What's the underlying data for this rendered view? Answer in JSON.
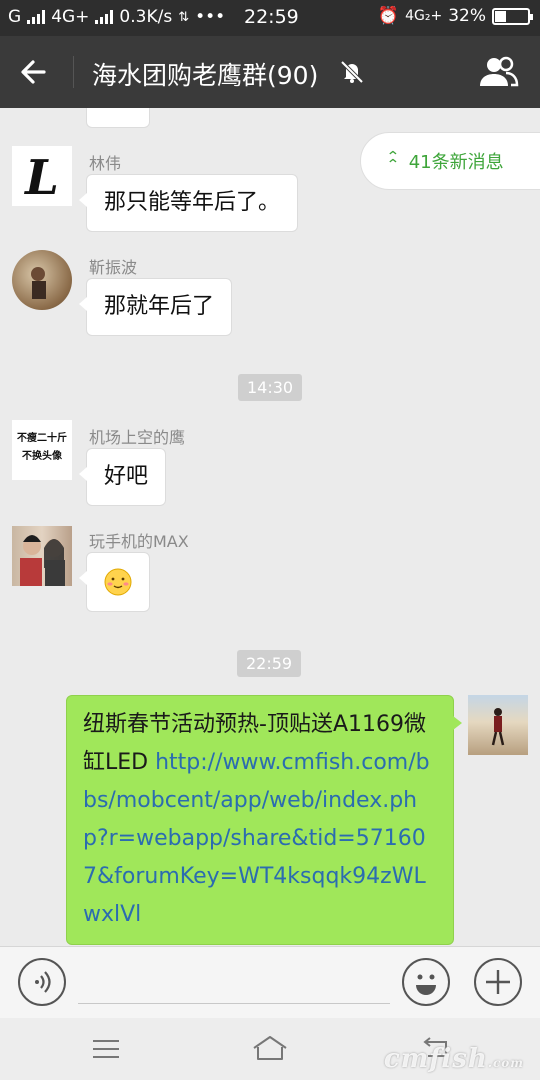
{
  "status_bar": {
    "carrier1": "G",
    "carrier2": "4G+",
    "speed": "0.3K/s",
    "dots": "•••",
    "time": "22:59",
    "net2": "4G₂+",
    "battery": "32%",
    "battery_level": 0.32
  },
  "header": {
    "title": "海水团购老鹰群(90)",
    "muted": true
  },
  "chat": {
    "new_messages": "41条新消息",
    "messages": [
      {
        "sender": "林伟",
        "text": "那只能等年后了。"
      },
      {
        "sender": "靳振波",
        "text": "那就年后了"
      },
      {
        "timestamp": "14:30"
      },
      {
        "sender": "机场上空的鹰",
        "text": "好吧",
        "avatar_lines": [
          "不瘦二十斤",
          "不换头像"
        ]
      },
      {
        "sender": "玩手机的MAX",
        "text": "😶"
      },
      {
        "timestamp": "22:59"
      }
    ],
    "own_message": {
      "text": "纽斯春节活动预热-顶贴送A1169微缸LED ",
      "link": "http://www.cmfish.com/bbs/mobcent/app/web/index.php?r=webapp/share&tid=571607&forumKey=WT4ksqqk94zWLwxlVl"
    }
  },
  "watermark": {
    "main": "cmfish",
    "suffix": ".com"
  },
  "colors": {
    "header_bg": "#3a3a3a",
    "chat_bg": "#ebebeb",
    "own_bubble": "#a0e75a",
    "new_msg_accent": "#3ea53a",
    "link": "#2b6cb0"
  }
}
